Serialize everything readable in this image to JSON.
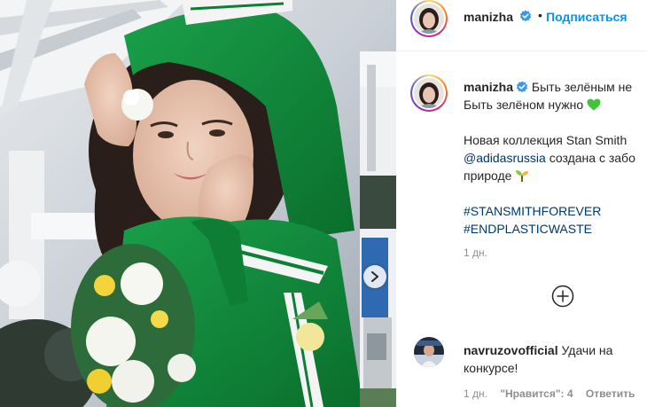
{
  "post": {
    "author": {
      "username": "manizha",
      "verified": true,
      "follow_label": "Подписаться",
      "separator": "•"
    },
    "caption": {
      "line1": "Быть зелёным не",
      "line2": "Быть зелёном нужно",
      "line3": "Новая коллекция Stan Smith",
      "mention": "@adidasrussia",
      "line4_rest": " создана с забо",
      "line5": "природе",
      "hashtags": [
        "#STANSMITHFOREVER",
        "#ENDPLASTICWASTE"
      ],
      "time": "1 дн.",
      "emoji_heart": "green-heart-icon",
      "emoji_sprout": "seedling-icon"
    },
    "comments": [
      {
        "username": "navruzovofficial",
        "text_part1": "Удачи на",
        "text_part2": "конкурсе!",
        "time": "1 дн.",
        "likes_label": "\"Нравится\": 4",
        "reply_label": "Ответить"
      }
    ]
  },
  "colors": {
    "link_blue": "#0095f6",
    "mention": "#00376b",
    "muted": "#8e8e8e",
    "verified": "#3897f0",
    "jacket_green": "#0f8a3a"
  }
}
